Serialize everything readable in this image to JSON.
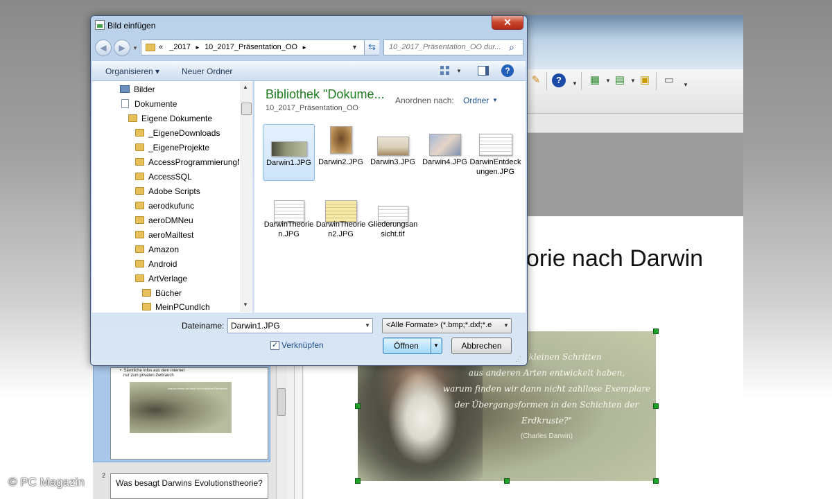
{
  "dialog": {
    "title": "Bild einfügen",
    "close_glyph": "✕",
    "address": {
      "prefix": "«",
      "segments": [
        "_2017",
        "10_2017_Präsentation_OO"
      ],
      "separator": "►"
    },
    "search_placeholder": "10_2017_Präsentation_OO dur...",
    "toolbar": {
      "organize_label": "Organisieren ▾",
      "new_folder_label": "Neuer Ordner",
      "help_glyph": "?"
    },
    "nav_items": [
      {
        "label": "Bilder",
        "kind": "library"
      },
      {
        "label": "Dokumente",
        "kind": "document"
      },
      {
        "label": "Eigene Dokumente",
        "kind": "folder"
      },
      {
        "label": "_EigeneDownloads",
        "kind": "folder"
      },
      {
        "label": "_EigeneProjekte",
        "kind": "folder"
      },
      {
        "label": "AccessProgrammierungN",
        "kind": "folder"
      },
      {
        "label": "AccessSQL",
        "kind": "folder"
      },
      {
        "label": "Adobe Scripts",
        "kind": "folder"
      },
      {
        "label": "aerodkufunc",
        "kind": "folder"
      },
      {
        "label": "aeroDMNeu",
        "kind": "folder"
      },
      {
        "label": "aeroMailtest",
        "kind": "folder"
      },
      {
        "label": "Amazon",
        "kind": "folder"
      },
      {
        "label": "Android",
        "kind": "folder"
      },
      {
        "label": "ArtVerlage",
        "kind": "folder"
      },
      {
        "label": "Bücher",
        "kind": "folder"
      },
      {
        "label": "MeinPCundIch",
        "kind": "folder"
      }
    ],
    "library_title": "Bibliothek \"Dokume...",
    "library_subtitle": "10_2017_Präsentation_OO",
    "arrange_label": "Anordnen nach:",
    "arrange_value": "Ordner",
    "files": [
      {
        "name": "Darwin1.JPG",
        "selected": true
      },
      {
        "name": "Darwin2.JPG",
        "selected": false
      },
      {
        "name": "Darwin3.JPG",
        "selected": false
      },
      {
        "name": "Darwin4.JPG",
        "selected": false
      },
      {
        "name": "DarwinEntdeckungen.JPG",
        "selected": false
      },
      {
        "name": "DarwinTheorien.JPG",
        "selected": false
      },
      {
        "name": "DarwinTheorien2.JPG",
        "selected": false
      },
      {
        "name": "Gliederungsansicht.tif",
        "selected": false
      }
    ],
    "filename_label": "Dateiname:",
    "filename_value": "Darwin1.JPG",
    "filter_value": "<Alle Formate> (*.bmp;*.dxf;*.e",
    "link_checkbox": {
      "label": "Verknüpfen",
      "checked": true
    },
    "open_button": "Öffnen",
    "cancel_button": "Abbrechen"
  },
  "background": {
    "slide_title": "eorie nach Darwin",
    "quote_lines": [
      "Arten in kleinen Schritten",
      "aus anderen Arten entwickelt haben,",
      "warum finden wir dann nicht zahllose Exemplare",
      "der Übergangsformen in den Schichten der Erdkruste?\""
    ],
    "quote_author": "(Charles Darwin)",
    "thumb1_bullets": "•  Sämtliche Infos aus dem Internet\n   nur zum privaten Gebrauch",
    "thumb2_number": "2",
    "thumb2_title": "Was besagt Darwins Evolutionstheorie?",
    "watermark": "© PC Magazin"
  },
  "colors": {
    "accent": "#1e7b1e",
    "link": "#1e4f8a",
    "selection_handle": "#1fa32a"
  }
}
